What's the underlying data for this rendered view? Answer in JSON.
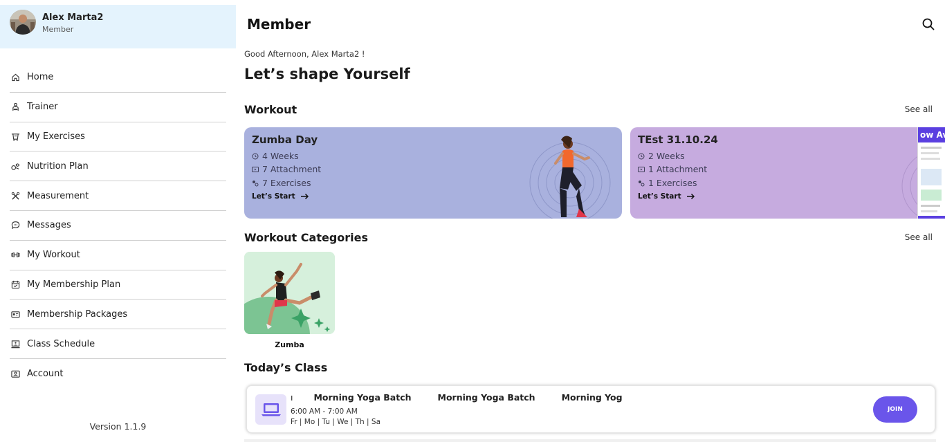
{
  "profile": {
    "name": "Alex Marta2",
    "role": "Member"
  },
  "nav": [
    {
      "label": "Home",
      "icon": "home-icon"
    },
    {
      "label": "Trainer",
      "icon": "trainer-icon"
    },
    {
      "label": "My Exercises",
      "icon": "exercises-icon"
    },
    {
      "label": "Nutrition Plan",
      "icon": "nutrition-icon"
    },
    {
      "label": "Measurement",
      "icon": "measurement-icon"
    },
    {
      "label": "Messages",
      "icon": "messages-icon"
    },
    {
      "label": "My Workout",
      "icon": "dumbbell-icon"
    },
    {
      "label": "My Membership Plan",
      "icon": "calendar-icon"
    },
    {
      "label": "Membership Packages",
      "icon": "package-icon"
    },
    {
      "label": "Class Schedule",
      "icon": "class-schedule-icon"
    },
    {
      "label": "Account",
      "icon": "account-icon"
    }
  ],
  "version": "Version 1.1.9",
  "header": {
    "title": "Member"
  },
  "greeting": "Good Afternoon, Alex Marta2 !",
  "headline": "Let’s shape Yourself",
  "workout": {
    "title": "Workout",
    "see_all": "See all",
    "cards": [
      {
        "title": "Zumba Day",
        "duration": "4 Weeks",
        "attachments": "7 Attachment",
        "exercises": "7 Exercises",
        "cta": "Let’s Start",
        "color": "#a9b1de"
      },
      {
        "title": "TEst 31.10.24",
        "duration": "2 Weeks",
        "attachments": "1 Attachment",
        "exercises": "1 Exercises",
        "cta": "Let’s Start",
        "color": "#c6abdf",
        "banner": "ow Av"
      }
    ]
  },
  "categories": {
    "title": "Workout Categories",
    "see_all": "See all",
    "items": [
      {
        "label": "Zumba"
      }
    ]
  },
  "today_class": {
    "title": "Today’s Class",
    "marquee": [
      "ı",
      "Morning Yoga Batch",
      "Morning Yoga Batch",
      "Morning Yoga Ba"
    ],
    "time": "6:00 AM - 7:00 AM",
    "days": "Fr | Mo | Tu | We | Th | Sa",
    "join_label": "JOIN"
  },
  "colors": {
    "accent": "#6a55ea",
    "profile_bg": "#e4f3fd"
  }
}
